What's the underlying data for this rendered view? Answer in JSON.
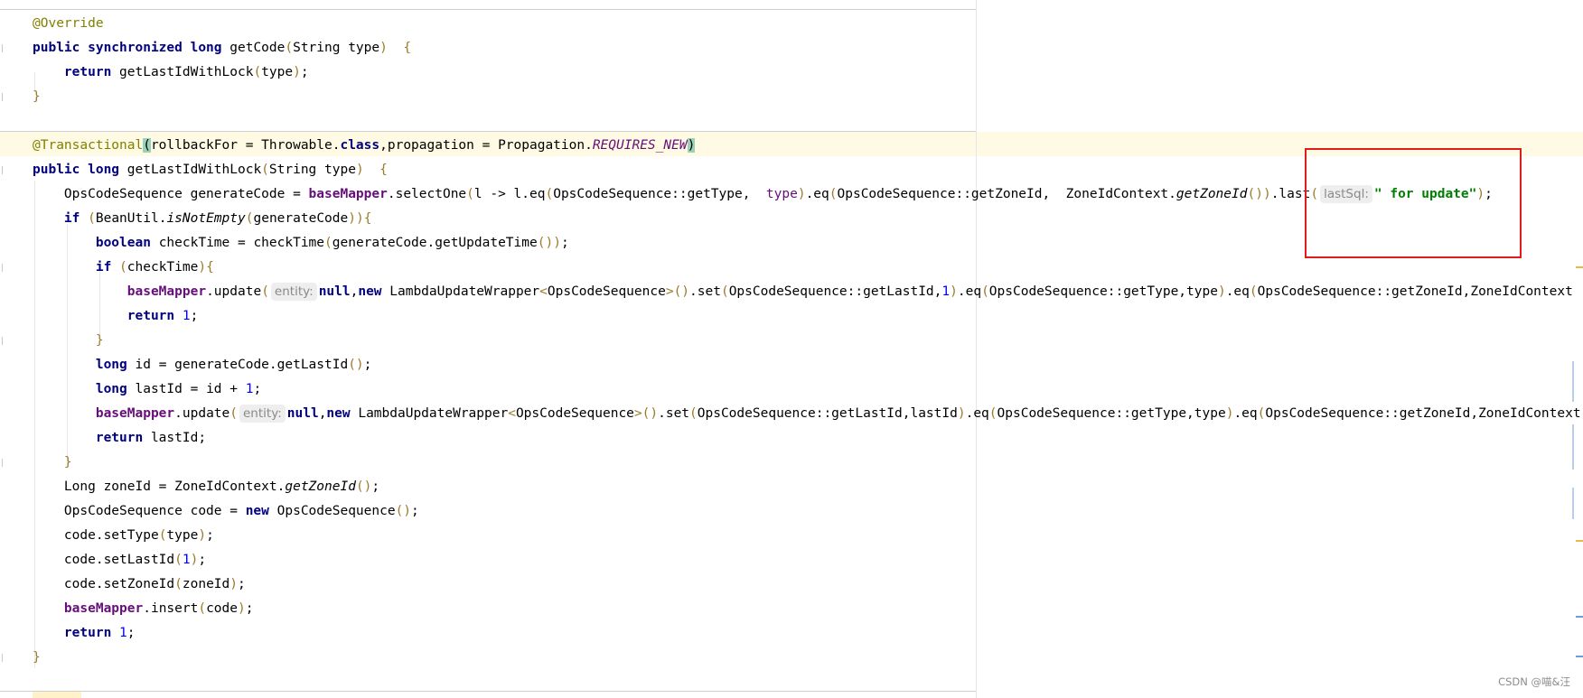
{
  "editor": {
    "lines": [
      {
        "id": "l01",
        "t": [
          [
            "ann",
            "@Override"
          ]
        ]
      },
      {
        "id": "l02",
        "t": [
          [
            "kw",
            "public synchronized long "
          ],
          [
            "",
            "getCode"
          ],
          [
            "br",
            "("
          ],
          [
            "",
            "String type"
          ],
          [
            "br",
            ")"
          ],
          [
            "",
            "  "
          ],
          [
            "br",
            "{"
          ]
        ]
      },
      {
        "id": "l03",
        "t": [
          [
            "",
            "    "
          ],
          [
            "kw",
            "return "
          ],
          [
            "",
            "getLastIdWithLock"
          ],
          [
            "br",
            "("
          ],
          [
            "",
            "type"
          ],
          [
            "br",
            ")"
          ],
          [
            "",
            ";"
          ]
        ]
      },
      {
        "id": "l04",
        "t": [
          [
            "br",
            "}"
          ]
        ]
      },
      {
        "id": "l05",
        "t": []
      },
      {
        "id": "l06",
        "t": [
          [
            "ann",
            "@Transactional"
          ],
          [
            "hl",
            "("
          ],
          [
            "",
            "rollbackFor = Throwable."
          ],
          [
            "kw",
            "class"
          ],
          [
            "",
            ",propagation = Propagation."
          ],
          [
            "stat",
            "REQUIRES_NEW"
          ],
          [
            "hl",
            ")"
          ]
        ]
      },
      {
        "id": "l07",
        "t": [
          [
            "kw",
            "public long "
          ],
          [
            "",
            "getLastIdWithLock"
          ],
          [
            "br",
            "("
          ],
          [
            "",
            "String type"
          ],
          [
            "br",
            ")"
          ],
          [
            "",
            "  "
          ],
          [
            "br",
            "{"
          ]
        ]
      },
      {
        "id": "l08",
        "t": [
          [
            "",
            "    OpsCodeSequence generateCode = "
          ],
          [
            "fld",
            "baseMapper"
          ],
          [
            "",
            ".selectOne"
          ],
          [
            "br",
            "("
          ],
          [
            "",
            "l -> l.eq"
          ],
          [
            "br",
            "("
          ],
          [
            "",
            "OpsCodeSequence::getType,  "
          ],
          [
            "par",
            "type"
          ],
          [
            "br",
            ")"
          ],
          [
            "",
            ".eq"
          ],
          [
            "br",
            "("
          ],
          [
            "",
            "OpsCodeSequence::getZoneId,  ZoneIdContext."
          ],
          [
            "itm",
            "getZoneId"
          ],
          [
            "br",
            "()"
          ],
          [
            "br",
            ")"
          ],
          [
            "",
            ".last"
          ],
          [
            "br",
            "("
          ],
          [
            "hint",
            "lastSql:"
          ],
          [
            "str",
            "\" for update\""
          ],
          [
            "br",
            ")"
          ],
          [
            "",
            ";"
          ]
        ]
      },
      {
        "id": "l09",
        "t": [
          [
            "",
            "    "
          ],
          [
            "kw",
            "if "
          ],
          [
            "br",
            "("
          ],
          [
            "",
            "BeanUtil."
          ],
          [
            "itm",
            "isNotEmpty"
          ],
          [
            "br",
            "("
          ],
          [
            "",
            "generateCode"
          ],
          [
            "br",
            ")"
          ],
          [
            "br",
            ")"
          ],
          [
            "br",
            "{"
          ]
        ]
      },
      {
        "id": "l10",
        "t": [
          [
            "",
            "        "
          ],
          [
            "kw",
            "boolean "
          ],
          [
            "",
            "checkTime = checkTime"
          ],
          [
            "br",
            "("
          ],
          [
            "",
            "generateCode.getUpdateTime"
          ],
          [
            "br",
            "()"
          ],
          [
            "br",
            ")"
          ],
          [
            "",
            ";"
          ]
        ]
      },
      {
        "id": "l11",
        "t": [
          [
            "",
            "        "
          ],
          [
            "kw",
            "if "
          ],
          [
            "br",
            "("
          ],
          [
            "",
            "checkTime"
          ],
          [
            "br",
            ")"
          ],
          [
            "br",
            "{"
          ]
        ]
      },
      {
        "id": "l12",
        "t": [
          [
            "",
            "            "
          ],
          [
            "fld",
            "baseMapper"
          ],
          [
            "",
            ".update"
          ],
          [
            "br",
            "("
          ],
          [
            "hint",
            "entity:"
          ],
          [
            "kw",
            "null"
          ],
          [
            "",
            ","
          ],
          [
            "kw",
            "new "
          ],
          [
            "",
            "LambdaUpdateWrapper"
          ],
          [
            "br",
            "<"
          ],
          [
            "",
            "OpsCodeSequence"
          ],
          [
            "br",
            ">"
          ],
          [
            "br",
            "()"
          ],
          [
            "",
            ".set"
          ],
          [
            "br",
            "("
          ],
          [
            "",
            "OpsCodeSequence::getLastId,"
          ],
          [
            "num",
            "1"
          ],
          [
            "br",
            ")"
          ],
          [
            "",
            ".eq"
          ],
          [
            "br",
            "("
          ],
          [
            "",
            "OpsCodeSequence::getType,type"
          ],
          [
            "br",
            ")"
          ],
          [
            "",
            ".eq"
          ],
          [
            "br",
            "("
          ],
          [
            "",
            "OpsCodeSequence::getZoneId,ZoneIdContext"
          ]
        ]
      },
      {
        "id": "l13",
        "t": [
          [
            "",
            "            "
          ],
          [
            "kw",
            "return "
          ],
          [
            "num",
            "1"
          ],
          [
            "",
            ";"
          ]
        ]
      },
      {
        "id": "l14",
        "t": [
          [
            "",
            "        "
          ],
          [
            "br",
            "}"
          ]
        ]
      },
      {
        "id": "l15",
        "t": [
          [
            "",
            "        "
          ],
          [
            "kw",
            "long "
          ],
          [
            "",
            "id = generateCode.getLastId"
          ],
          [
            "br",
            "()"
          ],
          [
            "",
            ";"
          ]
        ]
      },
      {
        "id": "l16",
        "t": [
          [
            "",
            "        "
          ],
          [
            "kw",
            "long "
          ],
          [
            "",
            "lastId = id + "
          ],
          [
            "num",
            "1"
          ],
          [
            "",
            ";"
          ]
        ]
      },
      {
        "id": "l17",
        "t": [
          [
            "",
            "        "
          ],
          [
            "fld",
            "baseMapper"
          ],
          [
            "",
            ".update"
          ],
          [
            "br",
            "("
          ],
          [
            "hint",
            "entity:"
          ],
          [
            "kw",
            "null"
          ],
          [
            "",
            ","
          ],
          [
            "kw",
            "new "
          ],
          [
            "",
            "LambdaUpdateWrapper"
          ],
          [
            "br",
            "<"
          ],
          [
            "",
            "OpsCodeSequence"
          ],
          [
            "br",
            ">"
          ],
          [
            "br",
            "()"
          ],
          [
            "",
            ".set"
          ],
          [
            "br",
            "("
          ],
          [
            "",
            "OpsCodeSequence::getLastId,lastId"
          ],
          [
            "br",
            ")"
          ],
          [
            "",
            ".eq"
          ],
          [
            "br",
            "("
          ],
          [
            "",
            "OpsCodeSequence::getType,type"
          ],
          [
            "br",
            ")"
          ],
          [
            "",
            ".eq"
          ],
          [
            "br",
            "("
          ],
          [
            "",
            "OpsCodeSequence::getZoneId,ZoneIdContext"
          ]
        ]
      },
      {
        "id": "l18",
        "t": [
          [
            "",
            "        "
          ],
          [
            "kw",
            "return "
          ],
          [
            "",
            "lastId;"
          ]
        ]
      },
      {
        "id": "l19",
        "t": [
          [
            "",
            "    "
          ],
          [
            "br",
            "}"
          ]
        ]
      },
      {
        "id": "l20",
        "t": [
          [
            "",
            "    Long zoneId = ZoneIdContext."
          ],
          [
            "itm",
            "getZoneId"
          ],
          [
            "br",
            "()"
          ],
          [
            "",
            ";"
          ]
        ]
      },
      {
        "id": "l21",
        "t": [
          [
            "",
            "    OpsCodeSequence code = "
          ],
          [
            "kw",
            "new "
          ],
          [
            "",
            "OpsCodeSequence"
          ],
          [
            "br",
            "()"
          ],
          [
            "",
            ";"
          ]
        ]
      },
      {
        "id": "l22",
        "t": [
          [
            "",
            "    code.setType"
          ],
          [
            "br",
            "("
          ],
          [
            "",
            "type"
          ],
          [
            "br",
            ")"
          ],
          [
            "",
            ";"
          ]
        ]
      },
      {
        "id": "l23",
        "t": [
          [
            "",
            "    code.setLastId"
          ],
          [
            "br",
            "("
          ],
          [
            "num",
            "1"
          ],
          [
            "br",
            ")"
          ],
          [
            "",
            ";"
          ]
        ]
      },
      {
        "id": "l24",
        "t": [
          [
            "",
            "    code.setZoneId"
          ],
          [
            "br",
            "("
          ],
          [
            "",
            "zoneId"
          ],
          [
            "br",
            ")"
          ],
          [
            "",
            ";"
          ]
        ]
      },
      {
        "id": "l25",
        "t": [
          [
            "",
            "    "
          ],
          [
            "fld",
            "baseMapper"
          ],
          [
            "",
            ".insert"
          ],
          [
            "br",
            "("
          ],
          [
            "",
            "code"
          ],
          [
            "br",
            ")"
          ],
          [
            "",
            ";"
          ]
        ]
      },
      {
        "id": "l26",
        "t": [
          [
            "",
            "    "
          ],
          [
            "kw",
            "return "
          ],
          [
            "num",
            "1"
          ],
          [
            "",
            ";"
          ]
        ]
      },
      {
        "id": "l27",
        "t": [
          [
            "br",
            "}"
          ]
        ]
      }
    ]
  },
  "watermark": "CSDN @喵&汪",
  "colors": {
    "keyword": "#000080",
    "annotation": "#808000",
    "field": "#660e7a",
    "string": "#008000",
    "number": "#0000ff",
    "highlight_box": "#e11b1b",
    "current_line": "#fffae3"
  }
}
